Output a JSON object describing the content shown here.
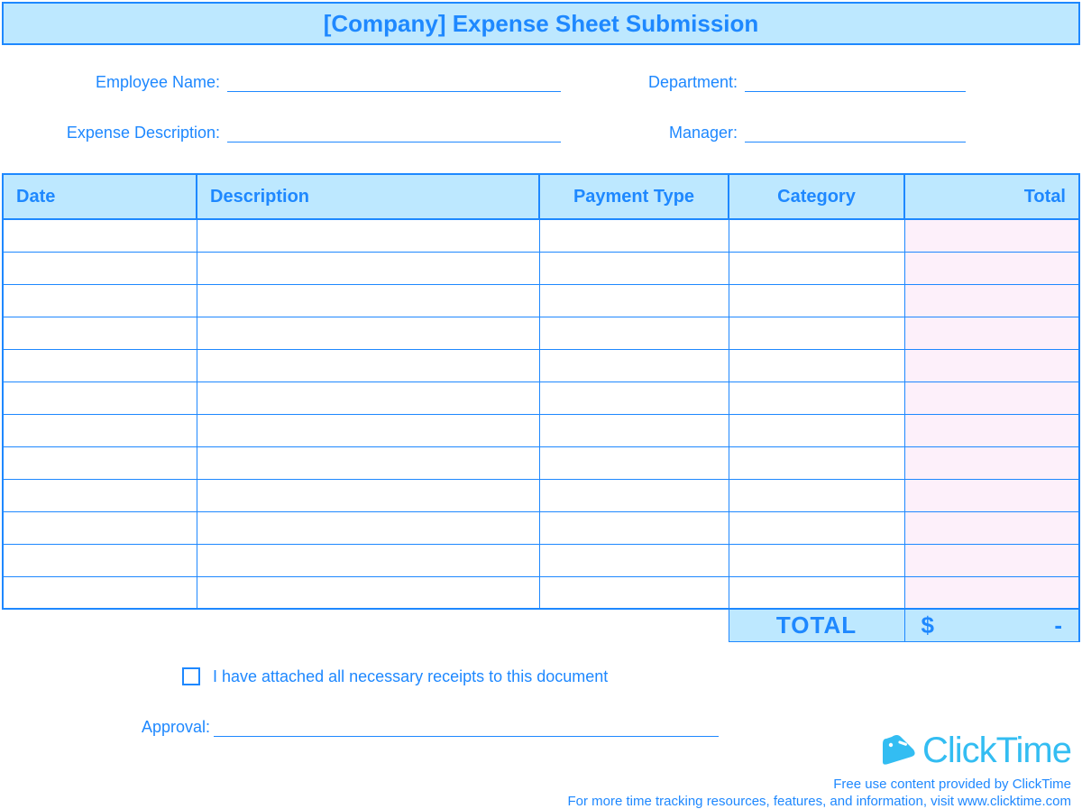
{
  "title": "[Company] Expense Sheet Submission",
  "fields": {
    "employee_name_label": "Employee Name:",
    "employee_name_value": "",
    "department_label": "Department:",
    "department_value": "",
    "expense_desc_label": "Expense Description:",
    "expense_desc_value": "",
    "manager_label": "Manager:",
    "manager_value": ""
  },
  "columns": {
    "date": "Date",
    "description": "Description",
    "payment_type": "Payment Type",
    "category": "Category",
    "total": "Total"
  },
  "rows": [
    {
      "date": "",
      "description": "",
      "payment_type": "",
      "category": "",
      "total": ""
    },
    {
      "date": "",
      "description": "",
      "payment_type": "",
      "category": "",
      "total": ""
    },
    {
      "date": "",
      "description": "",
      "payment_type": "",
      "category": "",
      "total": ""
    },
    {
      "date": "",
      "description": "",
      "payment_type": "",
      "category": "",
      "total": ""
    },
    {
      "date": "",
      "description": "",
      "payment_type": "",
      "category": "",
      "total": ""
    },
    {
      "date": "",
      "description": "",
      "payment_type": "",
      "category": "",
      "total": ""
    },
    {
      "date": "",
      "description": "",
      "payment_type": "",
      "category": "",
      "total": ""
    },
    {
      "date": "",
      "description": "",
      "payment_type": "",
      "category": "",
      "total": ""
    },
    {
      "date": "",
      "description": "",
      "payment_type": "",
      "category": "",
      "total": ""
    },
    {
      "date": "",
      "description": "",
      "payment_type": "",
      "category": "",
      "total": ""
    },
    {
      "date": "",
      "description": "",
      "payment_type": "",
      "category": "",
      "total": ""
    },
    {
      "date": "",
      "description": "",
      "payment_type": "",
      "category": "",
      "total": ""
    }
  ],
  "grand_total": {
    "label": "TOTAL",
    "currency": "$",
    "value": "-"
  },
  "attachment": {
    "checked": false,
    "label": "I have attached all necessary receipts to this document"
  },
  "approval": {
    "label": "Approval:",
    "value": ""
  },
  "brand": {
    "name": "ClickTime"
  },
  "footer": {
    "line1": "Free use content provided by ClickTime",
    "line2": "For more time tracking resources, features, and information, visit www.clicktime.com"
  }
}
